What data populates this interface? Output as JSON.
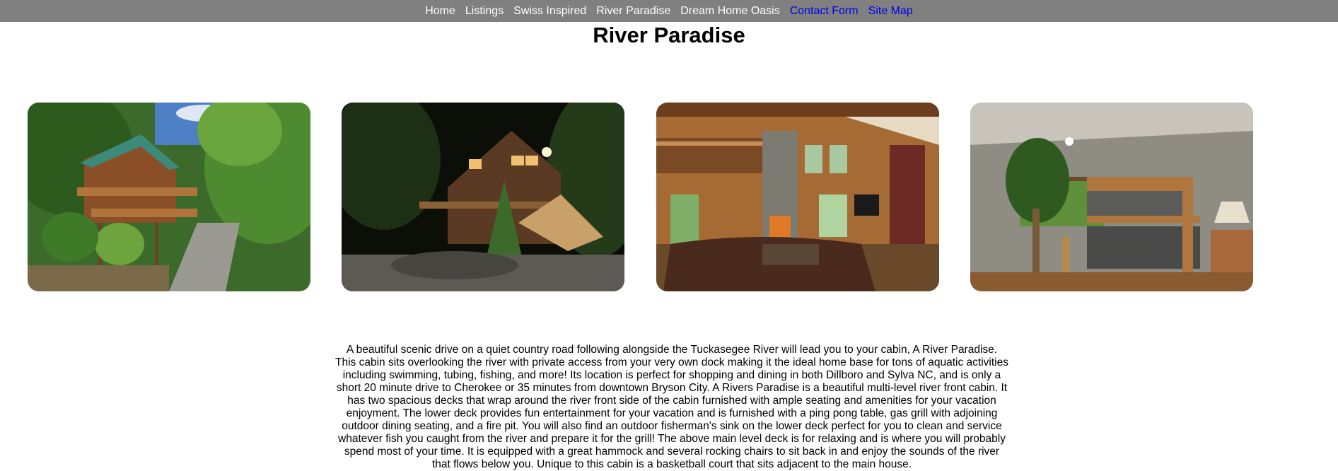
{
  "nav": {
    "items": [
      {
        "label": "Home",
        "color": "#ffffff"
      },
      {
        "label": "Listings",
        "color": "#ffffff"
      },
      {
        "label": "Swiss Inspired",
        "color": "#ffffff"
      },
      {
        "label": "River Paradise",
        "color": "#ffffff"
      },
      {
        "label": "Dream Home Oasis",
        "color": "#ffffff"
      },
      {
        "label": "Contact Form",
        "color": "#0000ee"
      },
      {
        "label": "Site Map",
        "color": "#0000ee"
      }
    ]
  },
  "page": {
    "title": "River Paradise",
    "description": "A beautiful scenic drive on a quiet country road following alongside the Tuckasegee River will lead you to your cabin, A River Paradise. This cabin sits overlooking the river with private access from your very own dock making it the ideal home base for tons of aquatic activities including swimming, tubing, fishing, and more! Its location is perfect for shopping and dining in both Dillboro and Sylva NC, and is only a short 20 minute drive to Cherokee or 35 minutes from downtown Bryson City. A Rivers Paradise is a beautiful multi-level river front cabin. It has two spacious decks that wrap around the river front side of the cabin furnished with ample seating and amenities for your vacation enjoyment. The lower deck provides fun entertainment for your vacation and is furnished with a ping pong table, gas grill with adjoining outdoor dining seating, and a fire pit. You will also find an outdoor fisherman's sink on the lower deck perfect for you to clean and service whatever fish you caught from the river and prepare it for the grill! The above main level deck is for relaxing and is where you will probably spend most of your time. It is equipped with a great hammock and several rocking chairs to sit back in and enjoy the sounds of the river that flows below you. Unique to this cabin is a basketball court that sits adjacent to the main house."
  },
  "colors": {
    "navbar_bg": "#808080",
    "link_blue": "#0000ee"
  }
}
